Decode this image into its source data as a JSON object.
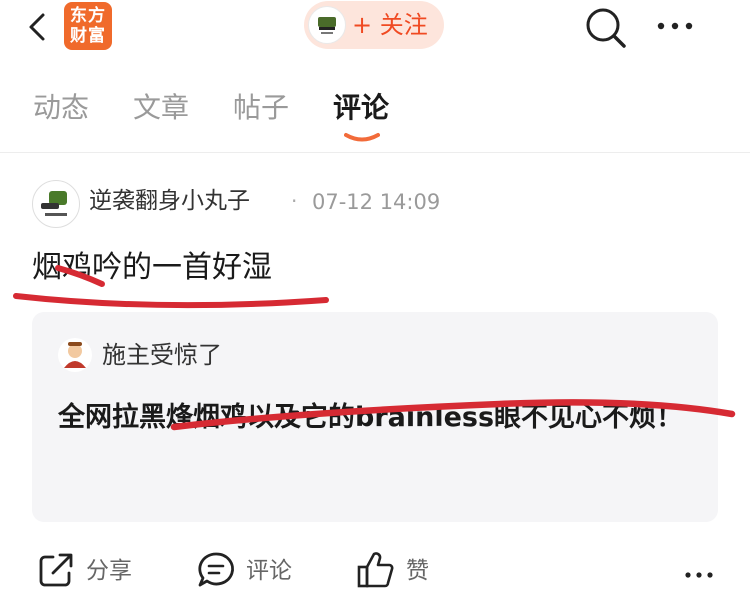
{
  "header": {
    "logo_line1": "东方",
    "logo_line2": "财富",
    "follow_label": "+ 关注",
    "icons": [
      "back-icon",
      "search-icon",
      "more-icon"
    ]
  },
  "tabs": [
    {
      "label": "动态",
      "active": false
    },
    {
      "label": "文章",
      "active": false
    },
    {
      "label": "帖子",
      "active": false
    },
    {
      "label": "评论",
      "active": true
    }
  ],
  "post": {
    "author": "逆袭翻身小丸子",
    "separator": "·",
    "time": "07-12 14:09",
    "content": "烟鸡吟的一首好湿",
    "quote": {
      "author": "施主受惊了",
      "text": "全网拉黑烽烟鸡以及它的brainless眼不见心不烦！"
    }
  },
  "actions": {
    "share_label": "分享",
    "comment_label": "评论",
    "like_label": "赞"
  },
  "colors": {
    "accent": "#f04a22",
    "logo_bg": "#f06a2b",
    "follow_bg": "#fde5dc",
    "tab_underline": "#f26b3a",
    "annotation": "#d62a33",
    "quote_bg": "#f5f5f7"
  }
}
